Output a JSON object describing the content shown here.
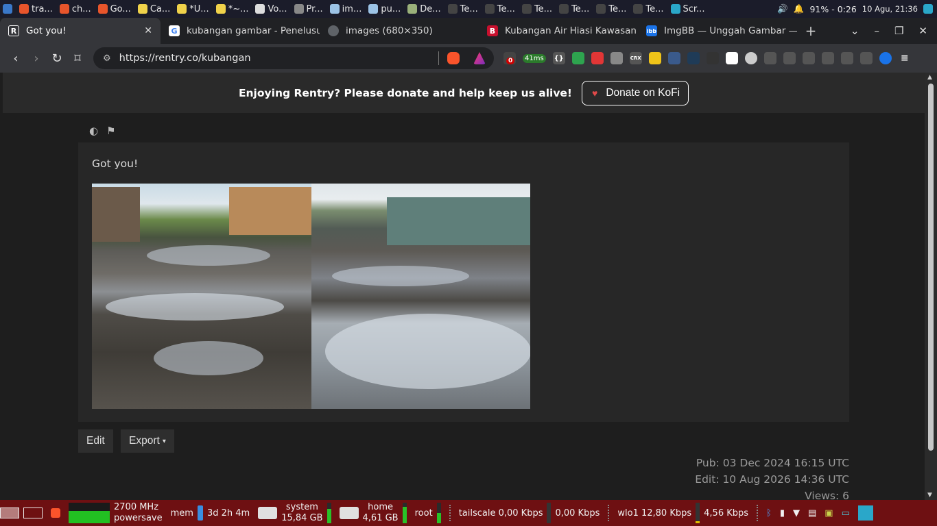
{
  "sysbar": {
    "apps": [
      {
        "label": "tra...",
        "color": "#e8552b"
      },
      {
        "label": "ch...",
        "color": "#e8552b"
      },
      {
        "label": "Go...",
        "color": "#e8552b"
      },
      {
        "label": "Ca...",
        "color": "#f0d24a"
      },
      {
        "label": "*U...",
        "color": "#f0d24a"
      },
      {
        "label": "*~...",
        "color": "#f0d24a"
      },
      {
        "label": "Vo...",
        "color": "#dddddd"
      },
      {
        "label": "Pr...",
        "color": "#888888"
      },
      {
        "label": "im...",
        "color": "#9cc3e6"
      },
      {
        "label": "pu...",
        "color": "#9cc3e6"
      },
      {
        "label": "De...",
        "color": "#9ab07a"
      },
      {
        "label": "Te...",
        "color": "#444444"
      },
      {
        "label": "Te...",
        "color": "#444444"
      },
      {
        "label": "Te...",
        "color": "#444444"
      },
      {
        "label": "Te...",
        "color": "#444444"
      },
      {
        "label": "Te...",
        "color": "#444444"
      },
      {
        "label": "Te...",
        "color": "#444444"
      },
      {
        "label": "Scr...",
        "color": "#2aa7c9"
      }
    ],
    "battery": "91% - 0:26",
    "datetime": "10 Agu, 21:36"
  },
  "tabs": [
    {
      "label": "Got you!",
      "fav": "R",
      "fav_color": "#35363a",
      "active": true,
      "close": "✕"
    },
    {
      "label": "kubangan gambar - Penelusu",
      "fav": "G",
      "fav_color": "#ffffff"
    },
    {
      "label": "images (680×350)",
      "fav": "",
      "fav_color": "#5f6368"
    },
    {
      "label": "Kubangan Air Hiasi Kawasan V",
      "fav": "B",
      "fav_color": "#c8102e"
    },
    {
      "label": "ImgBB — Unggah Gambar —",
      "fav": "ibb",
      "fav_color": "#1a73e8"
    }
  ],
  "new_tab": "+",
  "toolbar": {
    "url": "https://rentry.co/kubangan",
    "ext_badge": "0",
    "ext_ping": "41ms"
  },
  "banner": {
    "message": "Enjoying Rentry? Please donate and help keep us alive!",
    "donate_label": "Donate on KoFi"
  },
  "content": {
    "greeting": "Got you!",
    "edit_label": "Edit",
    "export_label": "Export",
    "pub": "Pub: 03 Dec 2024 16:15 UTC",
    "edit": "Edit: 10 Aug 2026 14:36 UTC",
    "views": "Views: 6"
  },
  "bottombar": {
    "cpu_freq": "2700 MHz",
    "cpu_gov": "powersave",
    "mem_label": "mem",
    "uptime": "3d 2h 4m",
    "system_label": "system",
    "system_size": "15,84 GB",
    "home_label": "home",
    "home_size": "4,61 GB",
    "root_label": "root",
    "tailscale": "tailscale 0,00 Kbps",
    "tailscale_up": "0,00 Kbps",
    "wlo1": "wlo1 12,80 Kbps",
    "wlo1_up": "4,56 Kbps"
  },
  "colors": {
    "background": "#1e1e1e",
    "card": "#272727",
    "banner": "#2a2a2a",
    "bottom_panel": "#6e1012"
  }
}
